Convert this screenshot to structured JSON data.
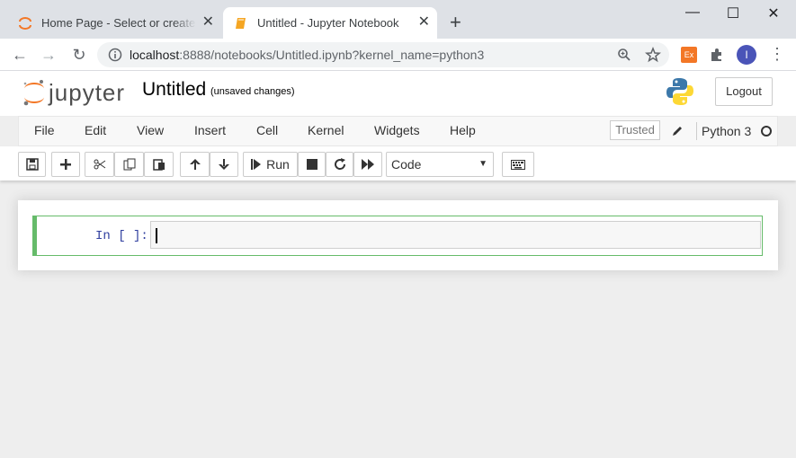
{
  "browser": {
    "tabs": [
      {
        "title": "Home Page - Select or create a",
        "close": "✕"
      },
      {
        "title": "Untitled - Jupyter Notebook",
        "close": "✕"
      }
    ],
    "new_tab": "+",
    "url_host": "localhost",
    "url_rest": ":8888/notebooks/Untitled.ipynb?kernel_name=python3",
    "extension_badge": "Ex",
    "profile_initial": "I",
    "window_controls": {
      "minimize": "—",
      "maximize": "☐",
      "close": "✕"
    }
  },
  "jupyter": {
    "logo_text": "jupyter",
    "notebook_name": "Untitled",
    "save_state": "(unsaved changes)",
    "logout_label": "Logout",
    "menu": [
      "File",
      "Edit",
      "View",
      "Insert",
      "Cell",
      "Kernel",
      "Widgets",
      "Help"
    ],
    "trusted_label": "Trusted",
    "kernel_name": "Python 3",
    "run_label": "Run",
    "cell_type": "Code",
    "cell": {
      "prompt": "In [ ]:",
      "source": ""
    }
  },
  "colors": {
    "selected_cell_border": "#66bb6a",
    "prompt": "#303f9f",
    "jupyter_orange": "#f37726"
  }
}
